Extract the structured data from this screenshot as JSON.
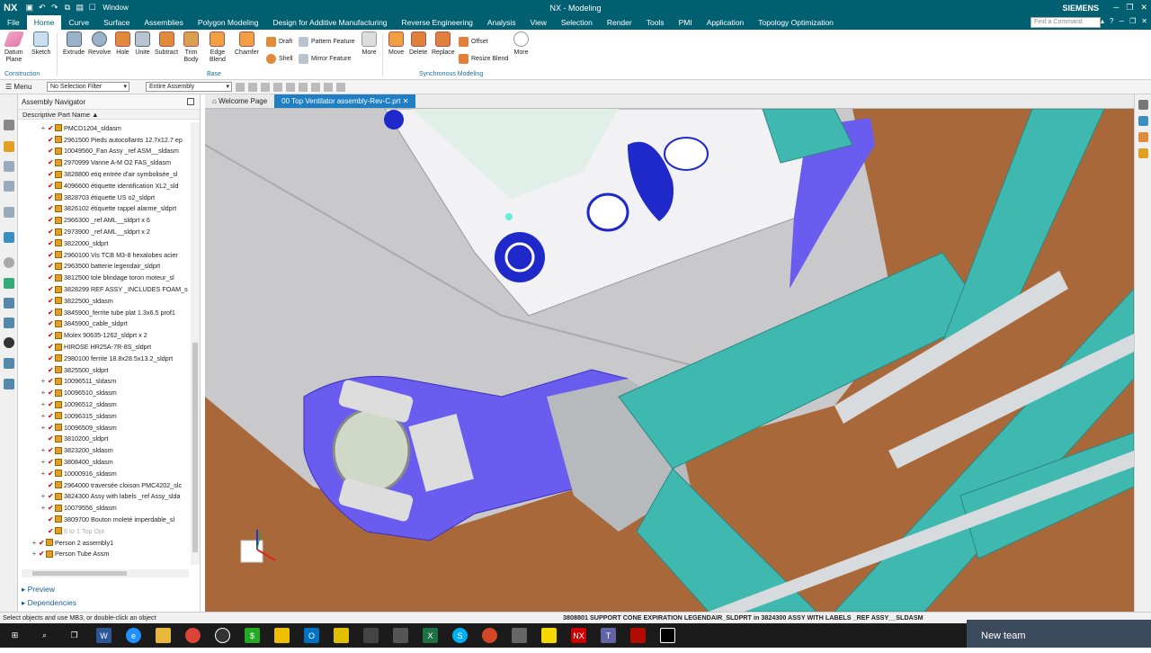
{
  "window": {
    "app_logo": "NX",
    "window_menu": "Window",
    "title": "NX - Modeling",
    "brand": "SIEMENS",
    "command_placeholder": "Find a Command"
  },
  "menu": {
    "items": [
      "File",
      "Home",
      "Curve",
      "Surface",
      "Assemblies",
      "Polygon Modeling",
      "Design for Additive Manufacturing",
      "Reverse Engineering",
      "Analysis",
      "View",
      "Selection",
      "Render",
      "Tools",
      "PMI",
      "Application",
      "Topology Optimization"
    ],
    "active": "Home"
  },
  "ribbon": {
    "construction": {
      "datum_plane": "Datum\nPlane",
      "sketch": "Sketch",
      "label": "Construction"
    },
    "base": {
      "extrude": "Extrude",
      "revolve": "Revolve",
      "hole": "Hole",
      "unite": "Unite",
      "subtract": "Subtract",
      "trim_body": "Trim\nBody",
      "edge_blend": "Edge\nBlend",
      "chamfer": "Chamfer",
      "draft": "Draft",
      "shell": "Shell",
      "pattern_feature": "Pattern Feature",
      "mirror_feature": "Mirror Feature",
      "more": "More",
      "label": "Base"
    },
    "sync": {
      "move": "Move",
      "delete": "Delete",
      "replace": "Replace",
      "offset": "Offset",
      "resize_blend": "Resize Blend",
      "more": "More",
      "label": "Synchronous Modeling"
    }
  },
  "filterbar": {
    "menu": "Menu",
    "selection_filter": "No Selection Filter",
    "scope": "Entire Assembly"
  },
  "navigator": {
    "title": "Assembly Navigator",
    "column": "Descriptive Part Name",
    "rows": [
      {
        "t": "PMCD1204_sldasm",
        "exp": true
      },
      {
        "t": "2961500 Pieds autocollants 12.7x12.7 ep"
      },
      {
        "t": "10049560_Fan Assy _ref ASM__sldasm"
      },
      {
        "t": "2970999 Vanne  A-M O2 FAS_sldasm"
      },
      {
        "t": "3828800 etiq entrée d'air symbolisée_sl"
      },
      {
        "t": "4096600 étiquette identification XL2_sld"
      },
      {
        "t": "3828703 étiquette US o2_sldprt"
      },
      {
        "t": "3826102 étiquette rappel alarme_sldprt"
      },
      {
        "t": "2966300 _ref AML__sldprt x 6"
      },
      {
        "t": "2973900 _ref AML__sldprt x 2"
      },
      {
        "t": "3822000_sldprt"
      },
      {
        "t": "2960100 Vis TCB M3-8 hexalobes acier"
      },
      {
        "t": "2963500 batterie legendair_sldprt"
      },
      {
        "t": "3812500 tole blindage toron moteur_sl"
      },
      {
        "t": "3828299 REF ASSY _INCLUDES FOAM_s"
      },
      {
        "t": "3822500_sldasm"
      },
      {
        "t": "3845900_ferrite tube plat 1.3x6.5 prof1"
      },
      {
        "t": "3845900_cable_sldprt"
      },
      {
        "t": "Molex 90635-1262_sldprt x 2"
      },
      {
        "t": "HIROSE HR25A-7R-8S_sldprt"
      },
      {
        "t": "2980100 ferrite 18.8x28.5x13.2_sldprt"
      },
      {
        "t": "3825500_sldprt"
      },
      {
        "t": "10096511_sldasm",
        "exp": true
      },
      {
        "t": "10096510_sldasm",
        "exp": true
      },
      {
        "t": "10096512_sldasm",
        "exp": true
      },
      {
        "t": "10096315_sldasm",
        "exp": true
      },
      {
        "t": "10096509_sldasm",
        "exp": true
      },
      {
        "t": "3810200_sldprt"
      },
      {
        "t": "3823200_sldasm",
        "exp": true
      },
      {
        "t": "3808400_sldasm",
        "exp": true
      },
      {
        "t": "10000916_sldasm",
        "exp": true
      },
      {
        "t": "2964000 traversée cloison PMC4202_slc"
      },
      {
        "t": "3824300 Assy with labels _ref Assy_slda",
        "exp": true
      },
      {
        "t": "10079556_sldasm",
        "exp": true
      },
      {
        "t": "3809700 Bouton moleté imperdable_sl"
      },
      {
        "t": "6 to 1 Top Opt",
        "dim": true
      },
      {
        "t": "Person 2 assembly1",
        "exp": true,
        "lvl": 0
      },
      {
        "t": "Person Tube Assm",
        "exp": true,
        "lvl": 0
      }
    ],
    "preview": "Preview",
    "dependencies": "Dependencies"
  },
  "tabs": [
    "Welcome Page",
    "00 Top Ventilator assembly-Rev-C.prt"
  ],
  "status": {
    "left": "Select objects and use MB3, or double-click an object",
    "right": "3808801 SUPPORT CONE EXPIRATION LEGENDAIR_SLDPRT in 3824300 ASSY WITH LABELS _REF ASSY__SLDASM"
  },
  "notification": "New team",
  "colors": {
    "nx_teal": "#005f70",
    "tab_blue": "#1f7ec4",
    "floor": "#a9683a",
    "tube": "#3fb8b0",
    "blue_part": "#6b5cf0"
  }
}
